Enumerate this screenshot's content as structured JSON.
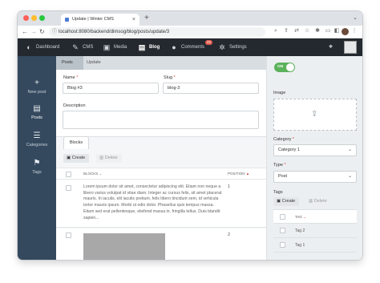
{
  "browser": {
    "tab_title": "Update | Winter CMS",
    "tab_close": "×",
    "new_tab": "+",
    "tab_menu": "⌄",
    "url": "localhost:8080/backend/dimsog/blog/posts/update/3",
    "traffic_lights": [
      "#fe5f57",
      "#febc2e",
      "#28c840"
    ]
  },
  "header": {
    "items": [
      {
        "label": "Dashboard",
        "icon": "dashboard-icon",
        "glyph": "◐"
      },
      {
        "label": "CMS",
        "icon": "cms-icon",
        "glyph": "✎"
      },
      {
        "label": "Media",
        "icon": "media-icon",
        "glyph": "▣"
      },
      {
        "label": "Blog",
        "icon": "blog-icon",
        "glyph": "▤"
      },
      {
        "label": "Comments",
        "icon": "comments-icon",
        "glyph": "●"
      },
      {
        "label": "Settings",
        "icon": "settings-icon",
        "glyph": "✲"
      }
    ],
    "comments_badge": "22"
  },
  "sidenav": {
    "items": [
      {
        "label": "New post",
        "icon": "plus-icon",
        "glyph": "+"
      },
      {
        "label": "Posts",
        "icon": "document-icon",
        "glyph": "▤"
      },
      {
        "label": "Categories",
        "icon": "list-icon",
        "glyph": "☰"
      },
      {
        "label": "Tags",
        "icon": "tag-icon",
        "glyph": "⚑"
      }
    ]
  },
  "breadcrumb": {
    "parent": "Posts",
    "current": "Update"
  },
  "form": {
    "name_label": "Name",
    "name_value": "Blog #3",
    "slug_label": "Slug",
    "slug_value": "blog-3",
    "description_label": "Description",
    "required_mark": "*"
  },
  "blocks": {
    "tab_label": "Blocks",
    "create_label": "Create",
    "delete_label": "Delete",
    "col_blocks": "BLOCKS",
    "col_position": "POSITION",
    "rows": [
      {
        "text": "Lorem ipsum dolor sit amet, consectetur adipiscing elit. Etiam non neque a libero varius volutpat id vitae diam. Integer ac cursus felis, sit amet placerat mauris. In iaculis, elit iaculis pretium, felis libero tincidunt sem, id vehicula tortor mauris ipsum. Morbi ut odio dolor. Phasellus quis tempus massa. Etiam sed erat pellentesque, eleifend massa in, fringilla tellus. Duis blandit sapien...",
        "position": "1"
      },
      {
        "text": "",
        "position": "2"
      }
    ]
  },
  "sidebar": {
    "toggle_label": "ON",
    "image_label": "Image",
    "category_label": "Category",
    "category_value": "Category 1",
    "type_label": "Type",
    "type_value": "Post",
    "tags_label": "Tags",
    "tags_create": "Create",
    "tags_delete": "Delete",
    "tags_header": "TAG",
    "tags": [
      "Tag 2",
      "Tag 1"
    ]
  }
}
